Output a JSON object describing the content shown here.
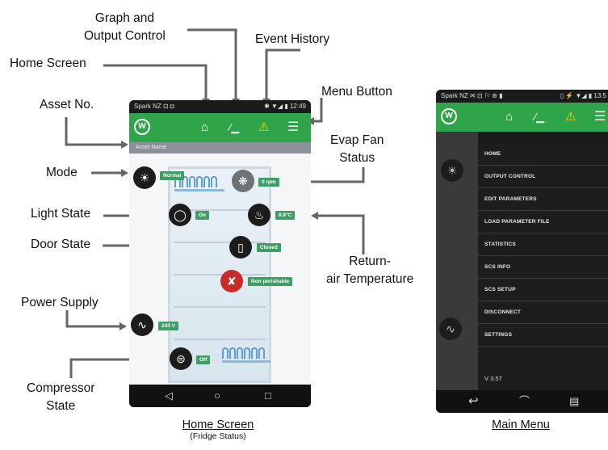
{
  "callouts": {
    "graph": [
      "Graph and",
      "Output Control"
    ],
    "event_history": "Event History",
    "home_screen": "Home Screen",
    "menu_button": "Menu Button",
    "asset_no": "Asset No.",
    "evap_fan": [
      "Evap Fan",
      "Status"
    ],
    "mode": "Mode",
    "light_state": "Light State",
    "door_state": "Door State",
    "return_air": [
      "Return-",
      "air Temperature"
    ],
    "power_supply": "Power Supply",
    "compressor": [
      "Compressor",
      "State"
    ]
  },
  "home_phone": {
    "status_left": "Spark NZ ⊡ ◘",
    "status_right": "✱ ▼◢ ▮ 12:49",
    "asset_name": "Asset Name",
    "tags": {
      "mode": "Normal",
      "fan": "0 rpm",
      "light": "On",
      "temp": "8.8°C",
      "door": "Closed",
      "perishable": "Non perishable",
      "power": "243 V",
      "compressor": "Off"
    }
  },
  "menu_phone": {
    "status_left": "Spark NZ ✉ ⊡ ⚐ ⊛ ▮",
    "status_right": "▯ ⚡ ▼◢ ▮ 13:5",
    "items": [
      "HOME",
      "OUTPUT CONTROL",
      "EDIT PARAMETERS",
      "LOAD PARAMETER FILE",
      "STATISTICS",
      "SCS INFO",
      "SCS SETUP",
      "DISCONNECT",
      "SETTINGS"
    ],
    "version": "V 3.57"
  },
  "captions": {
    "home_title": "Home Screen",
    "home_sub": "(Fridge Status)",
    "menu_title": "Main Menu"
  },
  "colors": {
    "app_bar": "#2fa448",
    "tag": "#3e9e65",
    "warning": "#ffd400"
  }
}
